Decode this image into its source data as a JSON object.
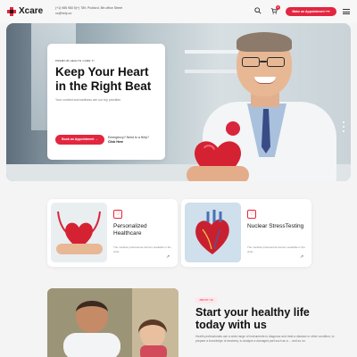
{
  "header": {
    "logo_text": "Xcare",
    "contact_line1": "(+1) 985 980 5(+) 789, Pickford, 5th office Street",
    "contact_line2": "xc@help.co",
    "search_icon": "search-icon",
    "cart_icon": "cart-icon",
    "cart_count": "0",
    "appointment_label": "Make an Appointment ⟶",
    "menu_icon": "hamburger-menu-icon"
  },
  "hero": {
    "tag": "PREMIUM HEALTH CARE TI",
    "title": "Keep Your Heart in the Right Beat",
    "description": "Your comfort and wellness are our top priorities",
    "cta_label": "Book an Appointment  →",
    "help_text": "Emergency? Need to a Help?",
    "help_action": "Click Here",
    "slide_count": 3
  },
  "services": [
    {
      "icon": "heart-hand-icon",
      "title": "Personalized Healthcare",
      "description": "The medical professional doctors available in the clinic",
      "arrow": "↗"
    },
    {
      "icon": "heart-pulse-icon",
      "title": "Nuclear StressTesting",
      "description": "The medical professional doctors available in the clinic",
      "arrow": "↗"
    }
  ],
  "about": {
    "tag": "ABOUT US",
    "title": "Start your healthy life today with us",
    "description": "Health professionals use a wide range of instruments to diagnose and treat a disease or other condition, to prepare a knowledge of anatomy, to analyze a damaged part such as a ... and so on."
  },
  "colors": {
    "accent": "#e3263f",
    "background": "#f4f4f4",
    "card": "#ffffff"
  }
}
